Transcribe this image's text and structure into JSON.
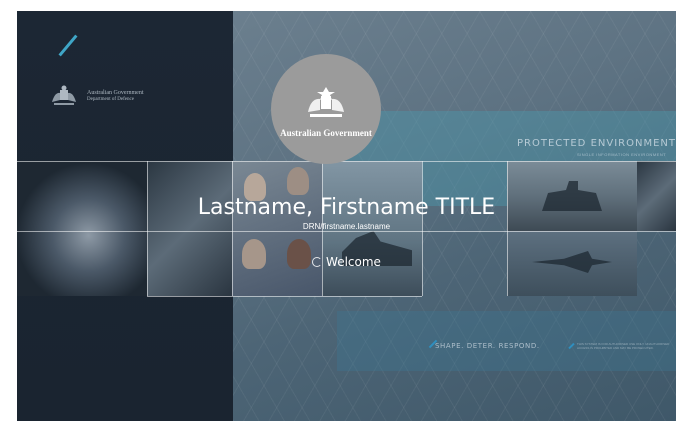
{
  "agency": {
    "name": "Australian Government",
    "department": "Department of Defence"
  },
  "banner": {
    "crest_caption": "Australian Government",
    "environment_title": "PROTECTED ENVIRONMENT -",
    "environment_subtitle": "SINGLE INFORMATION ENVIRONMENT",
    "slogan": "SHAPE. DETER. RESPOND.",
    "fine_print": "THIS SYSTEM IS FOR AUTHORISED USE ONLY. UNAUTHORISED ACCESS IS PROHIBITED AND MAY BE PROSECUTED."
  },
  "user": {
    "display_name": "Lastname, Firstname TITLE",
    "drn": "DRN/firstname.lastname"
  },
  "status": {
    "text": "Welcome"
  },
  "colors": {
    "left_panel": "#1c2734",
    "accent_blue": "#3fa6c7",
    "crest_circle": "#9b9b9b"
  }
}
